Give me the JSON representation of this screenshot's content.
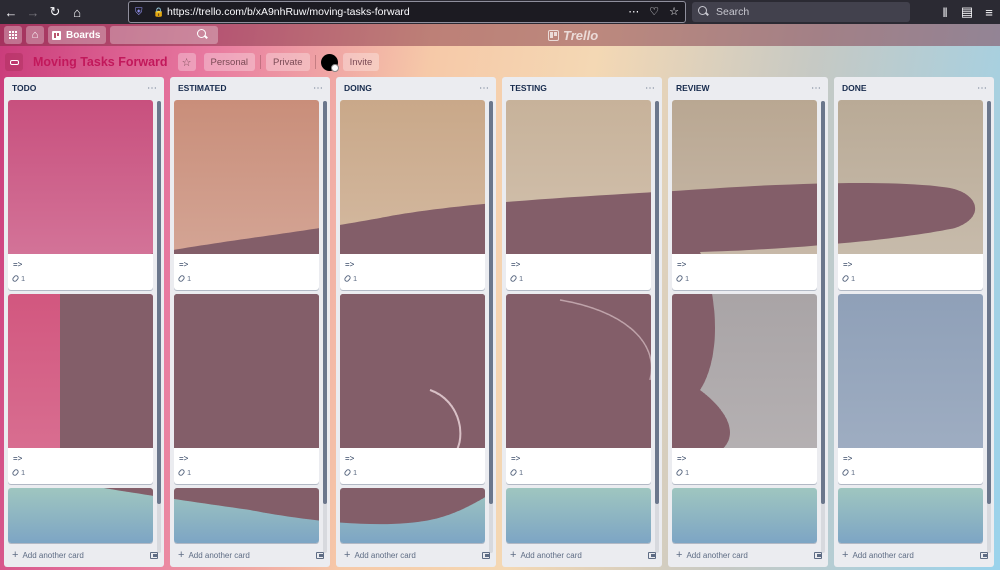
{
  "browser": {
    "url": "https://trello.com/b/xA9nhRuw/moving-tasks-forward",
    "search_placeholder": "Search"
  },
  "header": {
    "boards_label": "Boards",
    "logo_text": "Trello"
  },
  "board": {
    "title": "Moving Tasks Forward",
    "visibility_team": "Personal",
    "visibility_privacy": "Private",
    "invite_label": "Invite"
  },
  "lists": [
    {
      "title": "TODO",
      "add_card": "Add another card",
      "cards": [
        {
          "text": "=>",
          "attachments": "1"
        },
        {
          "text": "=>",
          "attachments": "1"
        }
      ]
    },
    {
      "title": "ESTIMATED",
      "add_card": "Add another card",
      "cards": [
        {
          "text": "=>",
          "attachments": "1"
        },
        {
          "text": "=>",
          "attachments": "1"
        }
      ]
    },
    {
      "title": "DOING",
      "add_card": "Add another card",
      "cards": [
        {
          "text": "=>",
          "attachments": "1"
        },
        {
          "text": "=>",
          "attachments": "1"
        }
      ]
    },
    {
      "title": "TESTING",
      "add_card": "Add another card",
      "cards": [
        {
          "text": "=>",
          "attachments": "1"
        },
        {
          "text": "=>",
          "attachments": "1"
        }
      ]
    },
    {
      "title": "REVIEW",
      "add_card": "Add another card",
      "cards": [
        {
          "text": "=>",
          "attachments": "1"
        },
        {
          "text": "=>",
          "attachments": "1"
        }
      ]
    },
    {
      "title": "DONE",
      "add_card": "Add another card",
      "cards": [
        {
          "text": "=>",
          "attachments": "1"
        },
        {
          "text": "=>",
          "attachments": "1"
        }
      ]
    }
  ],
  "colors": {
    "board_title": "#c2185b",
    "list_bg": "#ebecf0",
    "hand": "#7a5560"
  }
}
